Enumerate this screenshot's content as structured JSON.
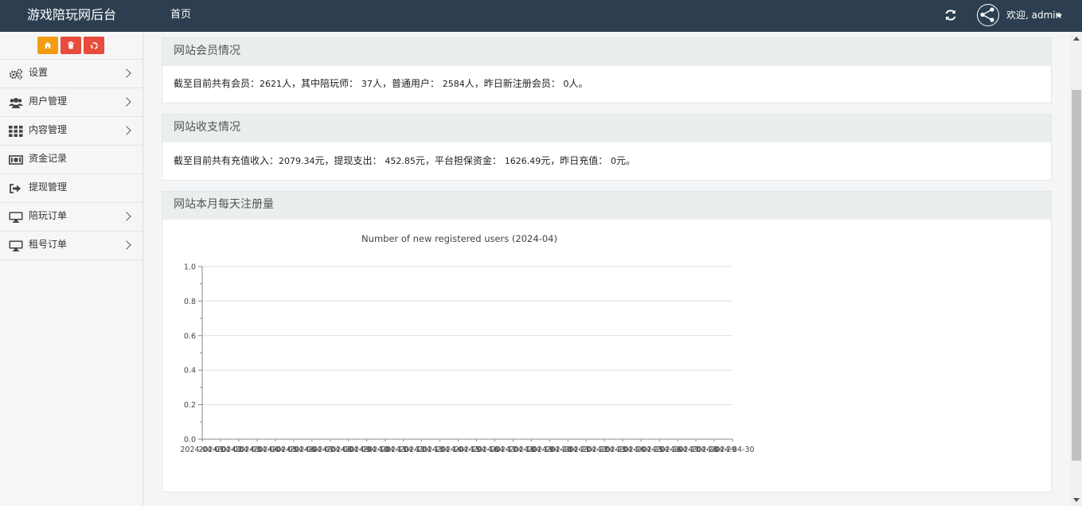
{
  "header": {
    "brand": "游戏陪玩网后台",
    "nav_home": "首页",
    "welcome": "欢迎, admin",
    "refresh_icon": "refresh-icon",
    "avatar_icon": "share-nodes-icon",
    "background": "#2c3e50"
  },
  "quick_buttons": [
    {
      "icon": "home-icon",
      "color": "#f39c12"
    },
    {
      "icon": "trash-icon",
      "color": "#e74c3c"
    },
    {
      "icon": "recycle-icon",
      "color": "#e74c3c"
    }
  ],
  "sidebar": {
    "items": [
      {
        "label": "设置",
        "icon": "gears-icon",
        "has_arrow": true
      },
      {
        "label": "用户管理",
        "icon": "users-icon",
        "has_arrow": true
      },
      {
        "label": "内容管理",
        "icon": "grid-icon",
        "has_arrow": true
      },
      {
        "label": "资金记录",
        "icon": "money-icon",
        "has_arrow": false
      },
      {
        "label": "提现管理",
        "icon": "sign-out-icon",
        "has_arrow": false
      },
      {
        "label": "陪玩订单",
        "icon": "desktop-icon",
        "has_arrow": true
      },
      {
        "label": "租号订单",
        "icon": "desktop-icon",
        "has_arrow": true
      }
    ]
  },
  "members": {
    "title": "网站会员情况",
    "text_1": "截至目前共有会员：",
    "total": "2621",
    "text_2": "人，其中陪玩师：",
    "companions": "37",
    "text_3": "人，普通用户：",
    "regular": "2584",
    "text_4": "人，昨日新注册会员：",
    "yesterday_new": "0",
    "text_5": "人。"
  },
  "finance": {
    "title": "网站收支情况",
    "text_1": "截至目前共有充值收入：",
    "recharge_income": "2079.34",
    "text_2": "元，提现支出：",
    "withdraw": "452.85",
    "text_3": "元，平台担保资金：",
    "guarantee": "1626.49",
    "text_4": "元，昨日充值：",
    "yesterday_recharge": "0",
    "text_5": "元。"
  },
  "registrations": {
    "title": "网站本月每天注册量"
  },
  "chart_data": {
    "type": "line",
    "title": "Number of new registered users (2024-04)",
    "xlabel": "",
    "ylabel": "",
    "x": [
      "2024-04-01",
      "2024-04-02",
      "2024-04-03",
      "2024-04-04",
      "2024-04-05",
      "2024-04-06",
      "2024-04-07",
      "2024-04-08",
      "2024-04-09",
      "2024-04-10",
      "2024-04-11",
      "2024-04-12",
      "2024-04-13",
      "2024-04-14",
      "2024-04-15",
      "2024-04-16",
      "2024-04-17",
      "2024-04-18",
      "2024-04-19",
      "2024-04-20",
      "2024-04-21",
      "2024-04-22",
      "2024-04-23",
      "2024-04-24",
      "2024-04-25",
      "2024-04-26",
      "2024-04-27",
      "2024-04-28",
      "2024-04-29",
      "2024-04-30"
    ],
    "series": [
      {
        "values": []
      }
    ],
    "yticks": [
      "0.0",
      "0.2",
      "0.4",
      "0.6",
      "0.8",
      "1.0"
    ],
    "ylim": [
      0,
      1.0
    ],
    "grid": true,
    "colors": {
      "grid": "#e0e0e0",
      "axis": "#888888",
      "text": "#444444"
    }
  }
}
